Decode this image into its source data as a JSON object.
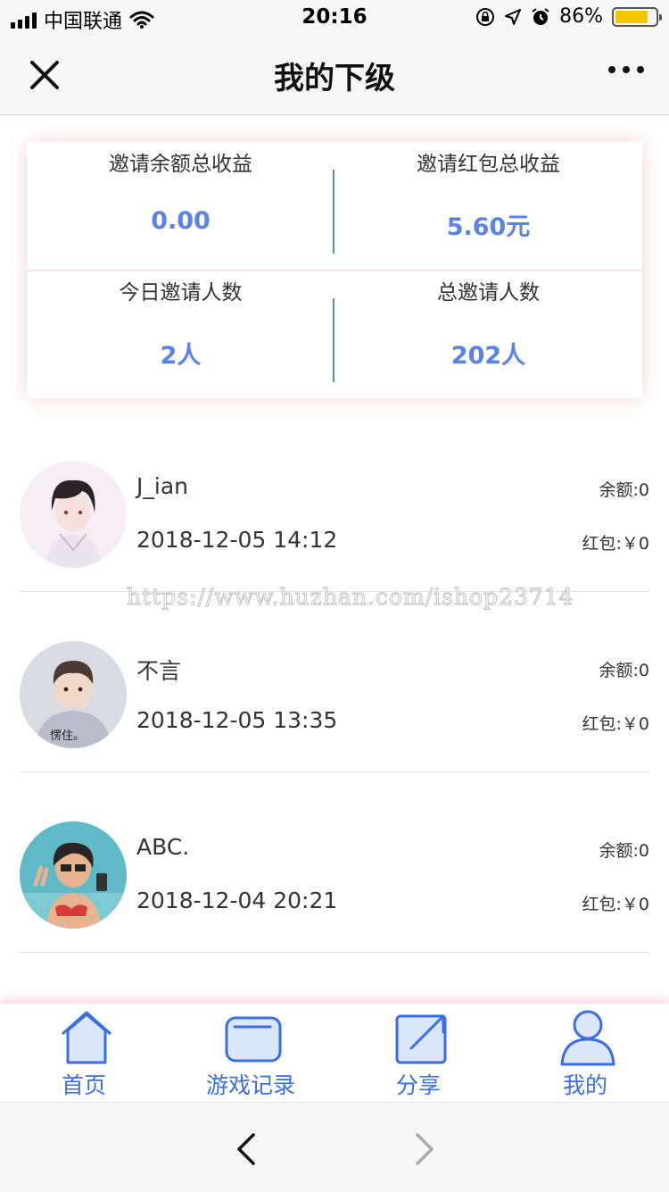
{
  "status_bar": {
    "carrier": "中国联通",
    "time": "20:16",
    "battery": "86%"
  },
  "nav": {
    "title": "我的下级"
  },
  "stats": {
    "invite_balance_label": "邀请余额总收益",
    "invite_balance_value": "0.00",
    "invite_redpacket_label": "邀请红包总收益",
    "invite_redpacket_value": "5.60元",
    "today_invites_label": "今日邀请人数",
    "today_invites_value": "2人",
    "total_invites_label": "总邀请人数",
    "total_invites_value": "202人"
  },
  "members": [
    {
      "name": "J_ian",
      "date": "2018-12-05 14:12",
      "balance": "余额:0",
      "redpacket": "红包:￥0"
    },
    {
      "name": "不言",
      "date": "2018-12-05 13:35",
      "balance": "余额:0",
      "redpacket": "红包:￥0",
      "avatar_caption": "愣住。"
    },
    {
      "name": "ABC.",
      "date": "2018-12-04 20:21",
      "balance": "余额:0",
      "redpacket": "红包:￥0"
    }
  ],
  "watermark": "https://www.huzhan.com/ishop23714",
  "tabs": [
    {
      "label": "首页",
      "icon": "home-icon"
    },
    {
      "label": "游戏记录",
      "icon": "game-record-icon"
    },
    {
      "label": "分享",
      "icon": "share-icon"
    },
    {
      "label": "我的",
      "icon": "user-icon"
    }
  ],
  "colors": {
    "accent": "#5b82e6",
    "tab": "#3a6ee6",
    "battery": "#f8c400"
  }
}
